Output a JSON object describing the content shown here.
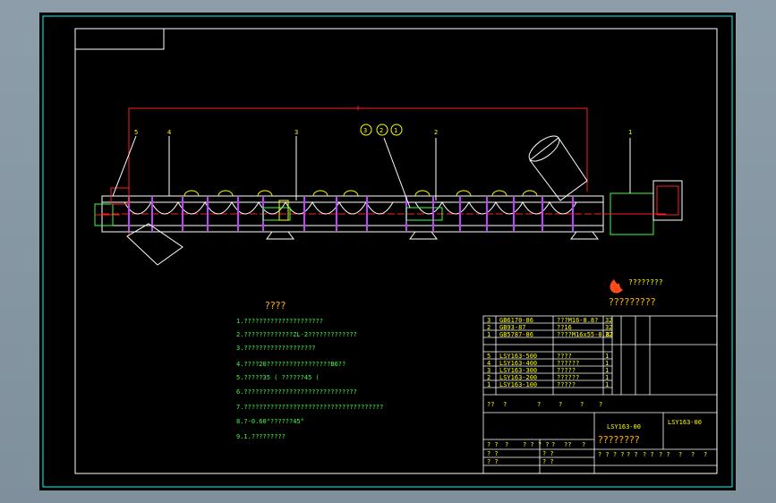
{
  "drawing": {
    "title_heading": "????",
    "balloons": [
      "5",
      "4",
      "3",
      "3",
      "2",
      "1",
      "2",
      "1"
    ],
    "logo_text": "????????",
    "logo_sub": "?????????",
    "notes": [
      "1.?????????????????????",
      "2.?????????????ZL-2?????????????",
      "3.???????????????????",
      "4.????20?????????????????B6??",
      "5.?????35 ( ??????45 (",
      "6.??????????????????????????????",
      "7.?????????????????????????????????????",
      "8.?-0.60\"??????45°",
      "9.1.?????????"
    ],
    "parts_upper": [
      {
        "no": "3",
        "code": "GB6170-86",
        "name": "???M16-8.8?",
        "qty": "32"
      },
      {
        "no": "2",
        "code": "GB93-87",
        "name": "??16",
        "qty": "32"
      },
      {
        "no": "1",
        "code": "GB5787-86",
        "name": "????M16x55-8.8?",
        "qty": "32"
      }
    ],
    "parts_lower": [
      {
        "no": "5",
        "code": "LSY163-500",
        "name": "????",
        "qty": "1"
      },
      {
        "no": "4",
        "code": "LSY163-400",
        "name": "??????",
        "qty": "1"
      },
      {
        "no": "3",
        "code": "LSY163-300",
        "name": "?????",
        "qty": "1"
      },
      {
        "no": "2",
        "code": "LSY163-200",
        "name": "??????",
        "qty": "1"
      },
      {
        "no": "1",
        "code": "LSY163-100",
        "name": "?????",
        "qty": "1"
      }
    ],
    "title_block": {
      "drawing_no_left": "LSY163-00",
      "drawing_no_right": "LSY163-00",
      "title": "????????",
      "header_cells": [
        "??",
        "?",
        "?",
        "?",
        "?",
        "?"
      ],
      "sig_row": [
        "? ?",
        "?",
        "? ? ? ?",
        "?",
        "??",
        "?"
      ],
      "scale_row": [
        "? ? ? ?",
        "? ?",
        "? ?",
        "? ?",
        "?",
        "?",
        "?"
      ],
      "stage_row": [
        "? ?",
        "? ?",
        "? ?",
        "? ?"
      ]
    }
  },
  "colors": {
    "border": "#00ffff",
    "dimension": "#ff2020",
    "labels": "#ffff00",
    "hatch": "#c040ff",
    "body": "#ffffff",
    "notes_green": "#3cff3c"
  }
}
